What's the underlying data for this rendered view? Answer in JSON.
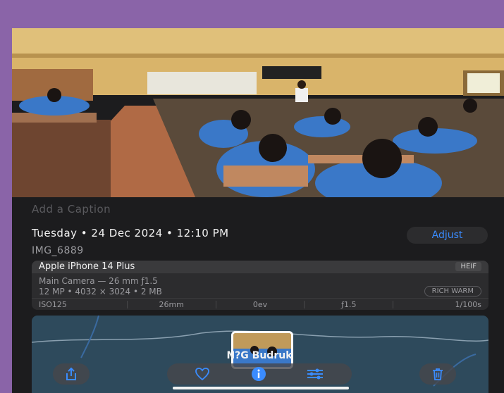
{
  "caption_placeholder": "Add a Caption",
  "date_line": "Tuesday • 24 Dec 2024 • 12:10 PM",
  "adjust_label": "Adjust",
  "filename": "IMG_6889",
  "device": {
    "name": "Apple iPhone 14 Plus",
    "format": "HEIF",
    "lens": "Main Camera — 26 mm ƒ1.5",
    "specs": "12 MP • 4032 × 3024 • 2 MB",
    "style": "RICH WARM"
  },
  "exif": [
    "ISO125",
    "26mm",
    "0ev",
    "ƒ1.5",
    "1/100s"
  ],
  "map_label": "N?G Budruk",
  "colors": {
    "accent": "#3a8cff",
    "background": "#1c1c1e",
    "frame": "#8a64a8"
  },
  "icons": {
    "share": "share-icon",
    "favorite": "heart-icon",
    "info": "info-icon",
    "edit": "sliders-icon",
    "delete": "trash-icon"
  }
}
